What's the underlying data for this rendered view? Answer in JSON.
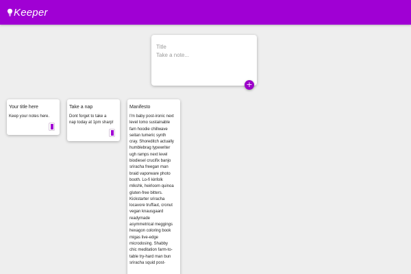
{
  "header": {
    "title": "Keeper"
  },
  "create_area": {
    "title_placeholder": "Title",
    "content_placeholder": "Take a note...",
    "add_label": "+"
  },
  "notes": [
    {
      "title": "Your title here",
      "content": "Keep your notes here."
    },
    {
      "title": "Take a nap",
      "content": "Dont forget to take a\nnap today at 1pm sharp!"
    },
    {
      "title": "Manifesto",
      "content": "I'm baby post-ironic next\nlevel lomo sustainable\nfam hoodie chillwave\nseitan tumeric synth\ncray. Shoreditch actually\nhumblebrag typewriter\nugh ramps next level\nbiodiesel crucifix banjo\nsriracha freegan man\nbraid vaporware photo\nbooth. Lo-fi kinfolk\nmlkshk, heirloom quinoa\ngluten-free bitters.\nKickstarter sriracha\nlocavore truffaut, cronut\nvegan knausgaard\nreadymade\nasymmetrical meggings\nhexagon coloring book\nmigas live-edge\nmicrodosing. Shabby\nchic meditation farm-to-\ntable try-hard man bun\nsriracha squid post-"
    }
  ],
  "colors": {
    "brand": "#a000d4",
    "background": "#eeeeee",
    "card": "#ffffff"
  },
  "icons": {
    "logo": "lightbulb-icon",
    "delete": "trash-icon"
  }
}
